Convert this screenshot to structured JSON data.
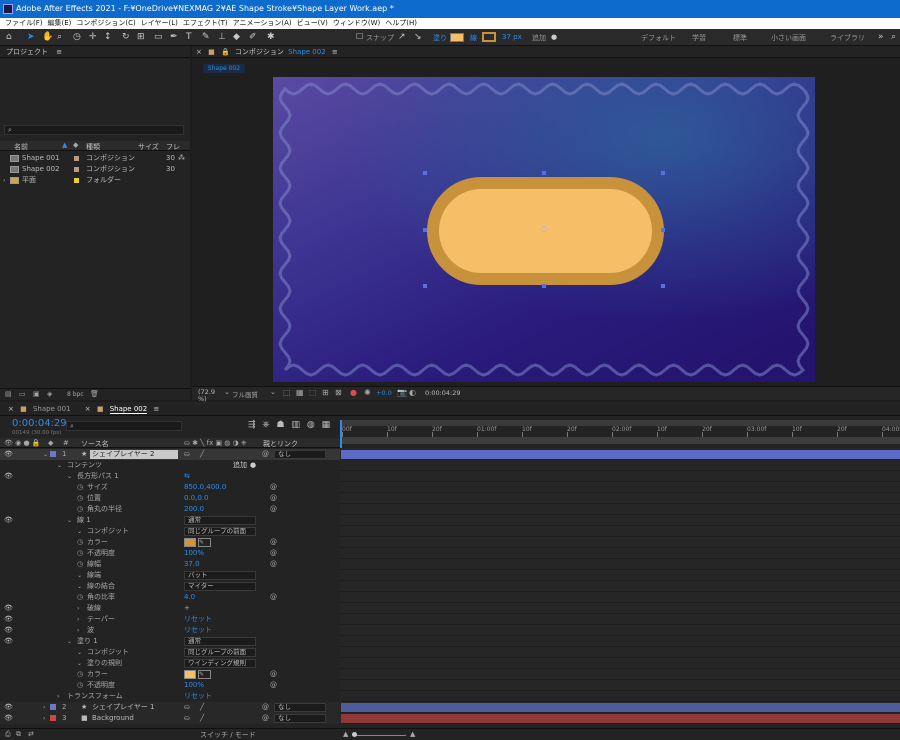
{
  "app": {
    "title": "Adobe After Effects 2021 - F:¥OneDrive¥NEXMAG 2¥AE Shape Stroke¥Shape Layer Work.aep *"
  },
  "menu": [
    "ファイル(F)",
    "編集(E)",
    "コンポジション(C)",
    "レイヤー(L)",
    "エフェクト(T)",
    "アニメーション(A)",
    "ビュー(V)",
    "ウィンドウ(W)",
    "ヘルプ(H)"
  ],
  "toolbar": {
    "snap": "スナップ",
    "fill": "塗り",
    "stroke": "線",
    "stroke_px": "37 px",
    "add": "追加",
    "workspaces": [
      "デフォルト",
      "学習",
      "標準",
      "小さい画面",
      "ライブラリ"
    ],
    "fill_color": "#f7be68",
    "stroke_color": "#c8913b"
  },
  "project": {
    "title": "プロジェクト",
    "columns": [
      "名前",
      "種類",
      "サイズ",
      "フレ"
    ],
    "search_placeholder": "",
    "items": [
      {
        "name": "Shape 001",
        "type": "コンポジション",
        "size": "30",
        "color": "#b79b7c"
      },
      {
        "name": "Shape 002",
        "type": "コンポジション",
        "size": "30",
        "color": "#b79b7c"
      },
      {
        "name": "平面",
        "type": "フォルダー",
        "size": "",
        "color": "#e6cf3a"
      }
    ],
    "bpc": "8 bpc"
  },
  "comp": {
    "header": "コンポジション",
    "name": "Shape 002",
    "tab": "Shape 002",
    "zoom": "(72.9 %)",
    "resolution": "フル画質",
    "exposure": "+0.0",
    "timecode": "0:00:04:29"
  },
  "timeline": {
    "tabs": [
      "Shape 001",
      "Shape 002"
    ],
    "timecode": "0:00:04:29",
    "fps_info": "00149 (30.00 fps)",
    "col_source": "ソース名",
    "col_parent": "親とリンク",
    "switch_mode": "スイッチ / モード",
    "ruler": [
      "00f",
      "10f",
      "20f",
      "01:00f",
      "10f",
      "20f",
      "02:00f",
      "10f",
      "20f",
      "03:00f",
      "10f",
      "20f",
      "04:00f"
    ],
    "rows": [
      {
        "indent": 0,
        "eye": "👁",
        "num": "1",
        "label": "シェイプレイヤー 2",
        "value": "",
        "parent": "なし",
        "kind": "layer",
        "sel": true
      },
      {
        "indent": 1,
        "eye": "",
        "label": "コンテンツ",
        "value": "",
        "extra": "追加"
      },
      {
        "indent": 2,
        "eye": "👁",
        "label": "長方形パス 1",
        "value": ""
      },
      {
        "indent": 3,
        "eye": "",
        "label": "サイズ",
        "value": "850.0,400.0",
        "blue": true,
        "stop": true
      },
      {
        "indent": 3,
        "eye": "",
        "label": "位置",
        "value": "0.0,0.0",
        "blue": true,
        "stop": true
      },
      {
        "indent": 3,
        "eye": "",
        "label": "角丸の半径",
        "value": "200.0",
        "blue": true,
        "stop": true
      },
      {
        "indent": 2,
        "eye": "👁",
        "label": "線 1",
        "value": "通常",
        "dd": true
      },
      {
        "indent": 3,
        "eye": "",
        "label": "コンポジット",
        "value": "同じグループの前面",
        "dd": true
      },
      {
        "indent": 3,
        "eye": "",
        "label": "カラー",
        "value": "",
        "swatch": "#d6923b",
        "stop": true
      },
      {
        "indent": 3,
        "eye": "",
        "label": "不透明度",
        "value": "100%",
        "blue": true,
        "stop": true
      },
      {
        "indent": 3,
        "eye": "",
        "label": "線幅",
        "value": "37.0",
        "blue": true,
        "stop": true
      },
      {
        "indent": 3,
        "eye": "",
        "label": "線端",
        "value": "バット",
        "dd": true
      },
      {
        "indent": 3,
        "eye": "",
        "label": "線の結合",
        "value": "マイター",
        "dd": true
      },
      {
        "indent": 3,
        "eye": "",
        "label": "角の比率",
        "value": "4.0",
        "blue": true,
        "stop": true
      },
      {
        "indent": 3,
        "eye": "👁",
        "label": "破線",
        "value": "+",
        "arrow": true
      },
      {
        "indent": 3,
        "eye": "👁",
        "label": "テーパー",
        "value": "リセット",
        "blue": true,
        "arrow": true
      },
      {
        "indent": 3,
        "eye": "👁",
        "label": "波",
        "value": "リセット",
        "blue": true,
        "arrow": true
      },
      {
        "indent": 2,
        "eye": "👁",
        "label": "塗り 1",
        "value": "通常",
        "dd": true
      },
      {
        "indent": 3,
        "eye": "",
        "label": "コンポジット",
        "value": "同じグループの前面",
        "dd": true
      },
      {
        "indent": 3,
        "eye": "",
        "label": "塗りの規則",
        "value": "ワインディング規則",
        "dd": true
      },
      {
        "indent": 3,
        "eye": "",
        "label": "カラー",
        "value": "",
        "swatch": "#f7be68",
        "stop": true
      },
      {
        "indent": 3,
        "eye": "",
        "label": "不透明度",
        "value": "100%",
        "blue": true,
        "stop": true
      },
      {
        "indent": 1,
        "eye": "",
        "label": "トランスフォーム",
        "value": "リセット",
        "blue": true,
        "arrow": true
      },
      {
        "indent": 0,
        "eye": "👁",
        "num": "2",
        "label": "シェイプレイヤー 1",
        "value": "",
        "parent": "なし",
        "kind": "layer",
        "color": "#6a78c8",
        "bar": "#4d5d9c"
      },
      {
        "indent": 0,
        "eye": "👁",
        "num": "3",
        "label": "Background",
        "value": "",
        "parent": "なし",
        "kind": "layer",
        "color": "#d24545",
        "bar": "#8f3838"
      }
    ]
  }
}
